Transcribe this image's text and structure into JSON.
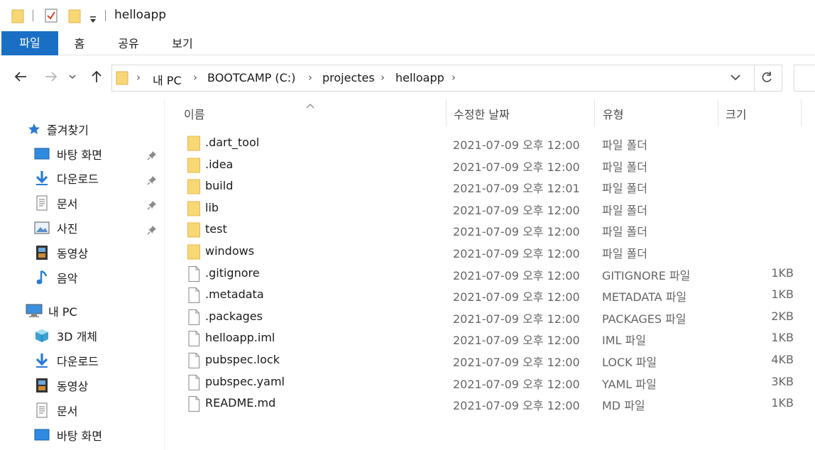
{
  "window": {
    "title": "helloapp"
  },
  "ribbon": {
    "tabs": [
      "파일",
      "홈",
      "공유",
      "보기"
    ]
  },
  "address": {
    "crumbs": [
      "내 PC",
      "BOOTCAMP (C:)",
      "projectes",
      "helloapp"
    ]
  },
  "sidebar": {
    "quick_access_label": "즐겨찾기",
    "quick_items": [
      {
        "label": "바탕 화면",
        "icon": "desktop-icon",
        "pinned": true
      },
      {
        "label": "다운로드",
        "icon": "download-icon",
        "pinned": true
      },
      {
        "label": "문서",
        "icon": "document-icon",
        "pinned": true
      },
      {
        "label": "사진",
        "icon": "picture-icon",
        "pinned": true
      },
      {
        "label": "동영상",
        "icon": "video-icon",
        "pinned": false
      },
      {
        "label": "음악",
        "icon": "music-icon",
        "pinned": false
      }
    ],
    "pc_label": "내 PC",
    "pc_items": [
      {
        "label": "3D 개체",
        "icon": "3d-objects-icon"
      },
      {
        "label": "다운로드",
        "icon": "download-icon"
      },
      {
        "label": "동영상",
        "icon": "video-icon"
      },
      {
        "label": "문서",
        "icon": "document-icon"
      },
      {
        "label": "바탕 화면",
        "icon": "desktop-icon"
      }
    ]
  },
  "columns": {
    "name": "이름",
    "date": "수정한 날짜",
    "type": "유형",
    "size": "크기"
  },
  "files": [
    {
      "name": ".dart_tool",
      "date": "2021-07-09 오후 12:00",
      "type": "파일 폴더",
      "size": "",
      "kind": "folder"
    },
    {
      "name": ".idea",
      "date": "2021-07-09 오후 12:00",
      "type": "파일 폴더",
      "size": "",
      "kind": "folder"
    },
    {
      "name": "build",
      "date": "2021-07-09 오후 12:01",
      "type": "파일 폴더",
      "size": "",
      "kind": "folder"
    },
    {
      "name": "lib",
      "date": "2021-07-09 오후 12:00",
      "type": "파일 폴더",
      "size": "",
      "kind": "folder"
    },
    {
      "name": "test",
      "date": "2021-07-09 오후 12:00",
      "type": "파일 폴더",
      "size": "",
      "kind": "folder"
    },
    {
      "name": "windows",
      "date": "2021-07-09 오후 12:00",
      "type": "파일 폴더",
      "size": "",
      "kind": "folder"
    },
    {
      "name": ".gitignore",
      "date": "2021-07-09 오후 12:00",
      "type": "GITIGNORE 파일",
      "size": "1KB",
      "kind": "file"
    },
    {
      "name": ".metadata",
      "date": "2021-07-09 오후 12:00",
      "type": "METADATA 파일",
      "size": "1KB",
      "kind": "file"
    },
    {
      "name": ".packages",
      "date": "2021-07-09 오후 12:00",
      "type": "PACKAGES 파일",
      "size": "2KB",
      "kind": "file"
    },
    {
      "name": "helloapp.iml",
      "date": "2021-07-09 오후 12:00",
      "type": "IML 파일",
      "size": "1KB",
      "kind": "file"
    },
    {
      "name": "pubspec.lock",
      "date": "2021-07-09 오후 12:00",
      "type": "LOCK 파일",
      "size": "4KB",
      "kind": "file"
    },
    {
      "name": "pubspec.yaml",
      "date": "2021-07-09 오후 12:00",
      "type": "YAML 파일",
      "size": "3KB",
      "kind": "file"
    },
    {
      "name": "README.md",
      "date": "2021-07-09 오후 12:00",
      "type": "MD 파일",
      "size": "1KB",
      "kind": "file"
    }
  ],
  "colors": {
    "accent": "#1a6fc4",
    "folder": "#f8d775",
    "folder_dark": "#e8b84a"
  }
}
